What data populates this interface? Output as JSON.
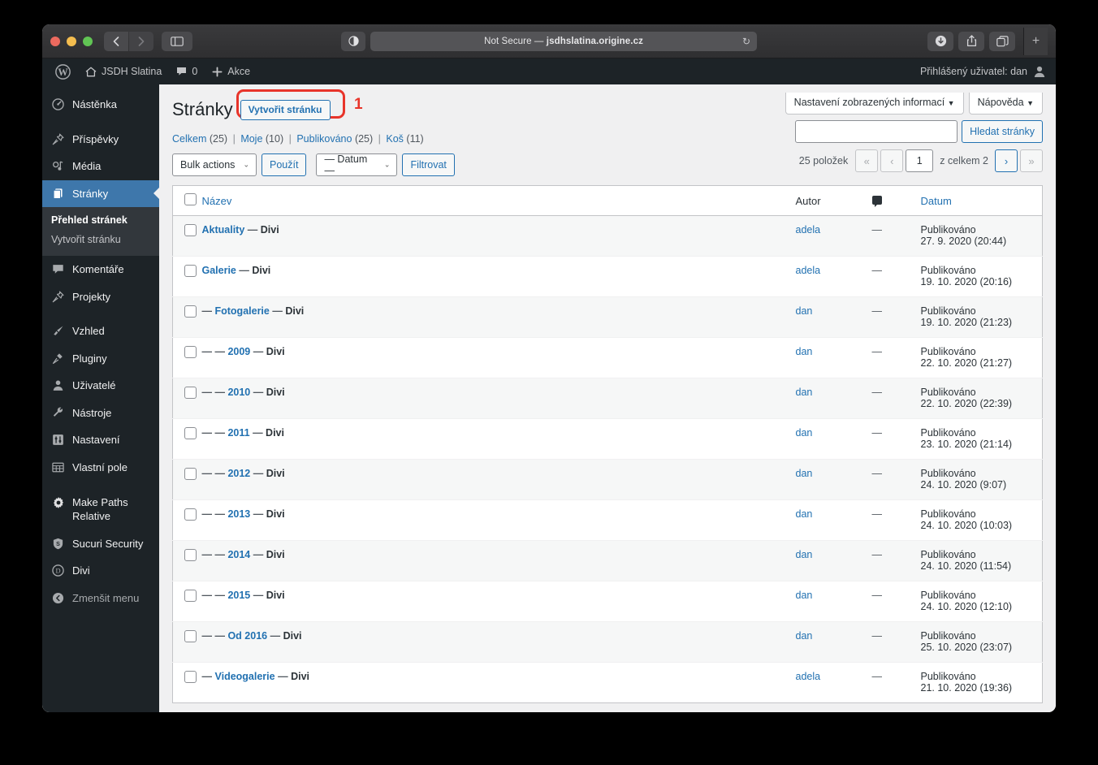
{
  "browser": {
    "back_icon": "chevron-left-icon",
    "forward_icon": "chevron-right-icon",
    "sidebar_icon": "sidebar-toggle-icon",
    "reader_icon": "reader-contrast-icon",
    "url_prefix": "Not Secure — ",
    "url_domain": "jsdhslatina.origine.cz",
    "reload_icon": "reload-icon",
    "download_icon": "download-icon",
    "share_icon": "share-icon",
    "tabs_icon": "tab-overview-icon",
    "newtab_icon": "plus-icon"
  },
  "adminbar": {
    "wp_logo": "wordpress-logo-icon",
    "site_icon": "home-icon",
    "site_name": "JSDH Slatina",
    "comments_icon": "comment-bubble-icon",
    "comments_count": "0",
    "new_icon": "plus-icon",
    "new_label": "Akce",
    "account_label": "Přihlášený uživatel: dan",
    "avatar_icon": "user-avatar-icon"
  },
  "sidebar": {
    "items": [
      {
        "label": "Nástěnka",
        "icon": "dashboard-icon"
      },
      {
        "label": "Příspěvky",
        "icon": "pin-icon"
      },
      {
        "label": "Média",
        "icon": "media-icon"
      },
      {
        "label": "Stránky",
        "icon": "pages-icon"
      },
      {
        "label": "Komentáře",
        "icon": "comment-bubble-icon"
      },
      {
        "label": "Projekty",
        "icon": "pin-icon"
      },
      {
        "label": "Vzhled",
        "icon": "appearance-brush-icon"
      },
      {
        "label": "Pluginy",
        "icon": "plugin-icon"
      },
      {
        "label": "Uživatelé",
        "icon": "users-icon"
      },
      {
        "label": "Nástroje",
        "icon": "tools-wrench-icon"
      },
      {
        "label": "Nastavení",
        "icon": "settings-sliders-icon"
      },
      {
        "label": "Vlastní pole",
        "icon": "custom-fields-grid-icon"
      },
      {
        "label": "Make Paths Relative",
        "icon": "gear-icon"
      },
      {
        "label": "Sucuri Security",
        "icon": "shield-icon"
      },
      {
        "label": "Divi",
        "icon": "divi-circle-icon"
      },
      {
        "label": "Zmenšit menu",
        "icon": "collapse-arrow-icon"
      }
    ],
    "submenu": [
      {
        "label": "Přehled stránek",
        "active": true
      },
      {
        "label": "Vytvořit stránku",
        "active": false
      }
    ]
  },
  "screen_meta": {
    "options_label": "Nastavení zobrazených informací",
    "help_label": "Nápověda",
    "caret": "▼"
  },
  "header": {
    "title": "Stránky",
    "add_new": "Vytvořit stránku",
    "annotation": "1"
  },
  "filters": {
    "items": [
      {
        "label": "Celkem",
        "count": "(25)"
      },
      {
        "label": "Moje",
        "count": "(10)"
      },
      {
        "label": "Publikováno",
        "count": "(25)"
      },
      {
        "label": "Koš",
        "count": "(11)"
      }
    ],
    "separator": "|"
  },
  "tablenav": {
    "bulk_actions": "Bulk actions",
    "apply": "Použít",
    "date_filter": "— Datum —",
    "filter_button": "Filtrovat",
    "caret": "⌄"
  },
  "search": {
    "value": "",
    "placeholder": "",
    "button": "Hledat stránky"
  },
  "pagination": {
    "count": "25 položek",
    "first": "«",
    "prev": "‹",
    "current": "1",
    "of_label": "z celkem 2",
    "next": "›",
    "last": "»"
  },
  "table": {
    "columns": {
      "title": "Název",
      "author": "Autor",
      "comments_icon": "comment-bubble-icon",
      "date": "Datum"
    },
    "rows": [
      {
        "prefix": "",
        "title": "Aktuality",
        "theme": "Divi",
        "author": "adela",
        "comments": "—",
        "status": "Publikováno",
        "date": "27. 9. 2020 (20:44)"
      },
      {
        "prefix": "",
        "title": "Galerie",
        "theme": "Divi",
        "author": "adela",
        "comments": "—",
        "status": "Publikováno",
        "date": "19. 10. 2020 (20:16)"
      },
      {
        "prefix": "—",
        "title": "Fotogalerie",
        "theme": "Divi",
        "author": "dan",
        "comments": "—",
        "status": "Publikováno",
        "date": "19. 10. 2020 (21:23)"
      },
      {
        "prefix": "— —",
        "title": "2009",
        "theme": "Divi",
        "author": "dan",
        "comments": "—",
        "status": "Publikováno",
        "date": "22. 10. 2020 (21:27)"
      },
      {
        "prefix": "— —",
        "title": "2010",
        "theme": "Divi",
        "author": "dan",
        "comments": "—",
        "status": "Publikováno",
        "date": "22. 10. 2020 (22:39)"
      },
      {
        "prefix": "— —",
        "title": "2011",
        "theme": "Divi",
        "author": "dan",
        "comments": "—",
        "status": "Publikováno",
        "date": "23. 10. 2020 (21:14)"
      },
      {
        "prefix": "— —",
        "title": "2012",
        "theme": "Divi",
        "author": "dan",
        "comments": "—",
        "status": "Publikováno",
        "date": "24. 10. 2020 (9:07)"
      },
      {
        "prefix": "— —",
        "title": "2013",
        "theme": "Divi",
        "author": "dan",
        "comments": "—",
        "status": "Publikováno",
        "date": "24. 10. 2020 (10:03)"
      },
      {
        "prefix": "— —",
        "title": "2014",
        "theme": "Divi",
        "author": "dan",
        "comments": "—",
        "status": "Publikováno",
        "date": "24. 10. 2020 (11:54)"
      },
      {
        "prefix": "— —",
        "title": "2015",
        "theme": "Divi",
        "author": "dan",
        "comments": "—",
        "status": "Publikováno",
        "date": "24. 10. 2020 (12:10)"
      },
      {
        "prefix": "— —",
        "title": "Od 2016",
        "theme": "Divi",
        "author": "dan",
        "comments": "—",
        "status": "Publikováno",
        "date": "25. 10. 2020 (23:07)"
      },
      {
        "prefix": "—",
        "title": "Videogalerie",
        "theme": "Divi",
        "author": "adela",
        "comments": "—",
        "status": "Publikováno",
        "date": "21. 10. 2020 (19:36)"
      }
    ],
    "em_dash": "—"
  },
  "colors": {
    "wp_blue": "#2271b1",
    "sidebar_bg": "#1d2327",
    "current_menu": "#3e77ab",
    "annotation_red": "#e8342a"
  }
}
